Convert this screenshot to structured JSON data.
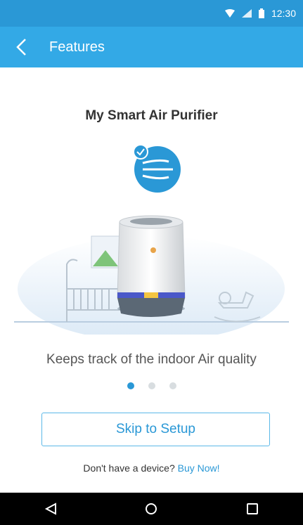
{
  "status_bar": {
    "time": "12:30"
  },
  "app_bar": {
    "title": "Features"
  },
  "main": {
    "device_title": "My Smart Air Purifier",
    "caption": "Keeps track of the indoor Air quality",
    "pager": {
      "pages": 3,
      "active_index": 0
    },
    "skip_label": "Skip to Setup",
    "no_device_text": "Don't have a device?",
    "buy_label": "Buy Now!"
  },
  "nav_bar": {
    "back": "back-icon",
    "home": "home-icon",
    "recents": "recents-icon"
  },
  "colors": {
    "accent": "#33a9e6",
    "status": "#2a98d6"
  }
}
